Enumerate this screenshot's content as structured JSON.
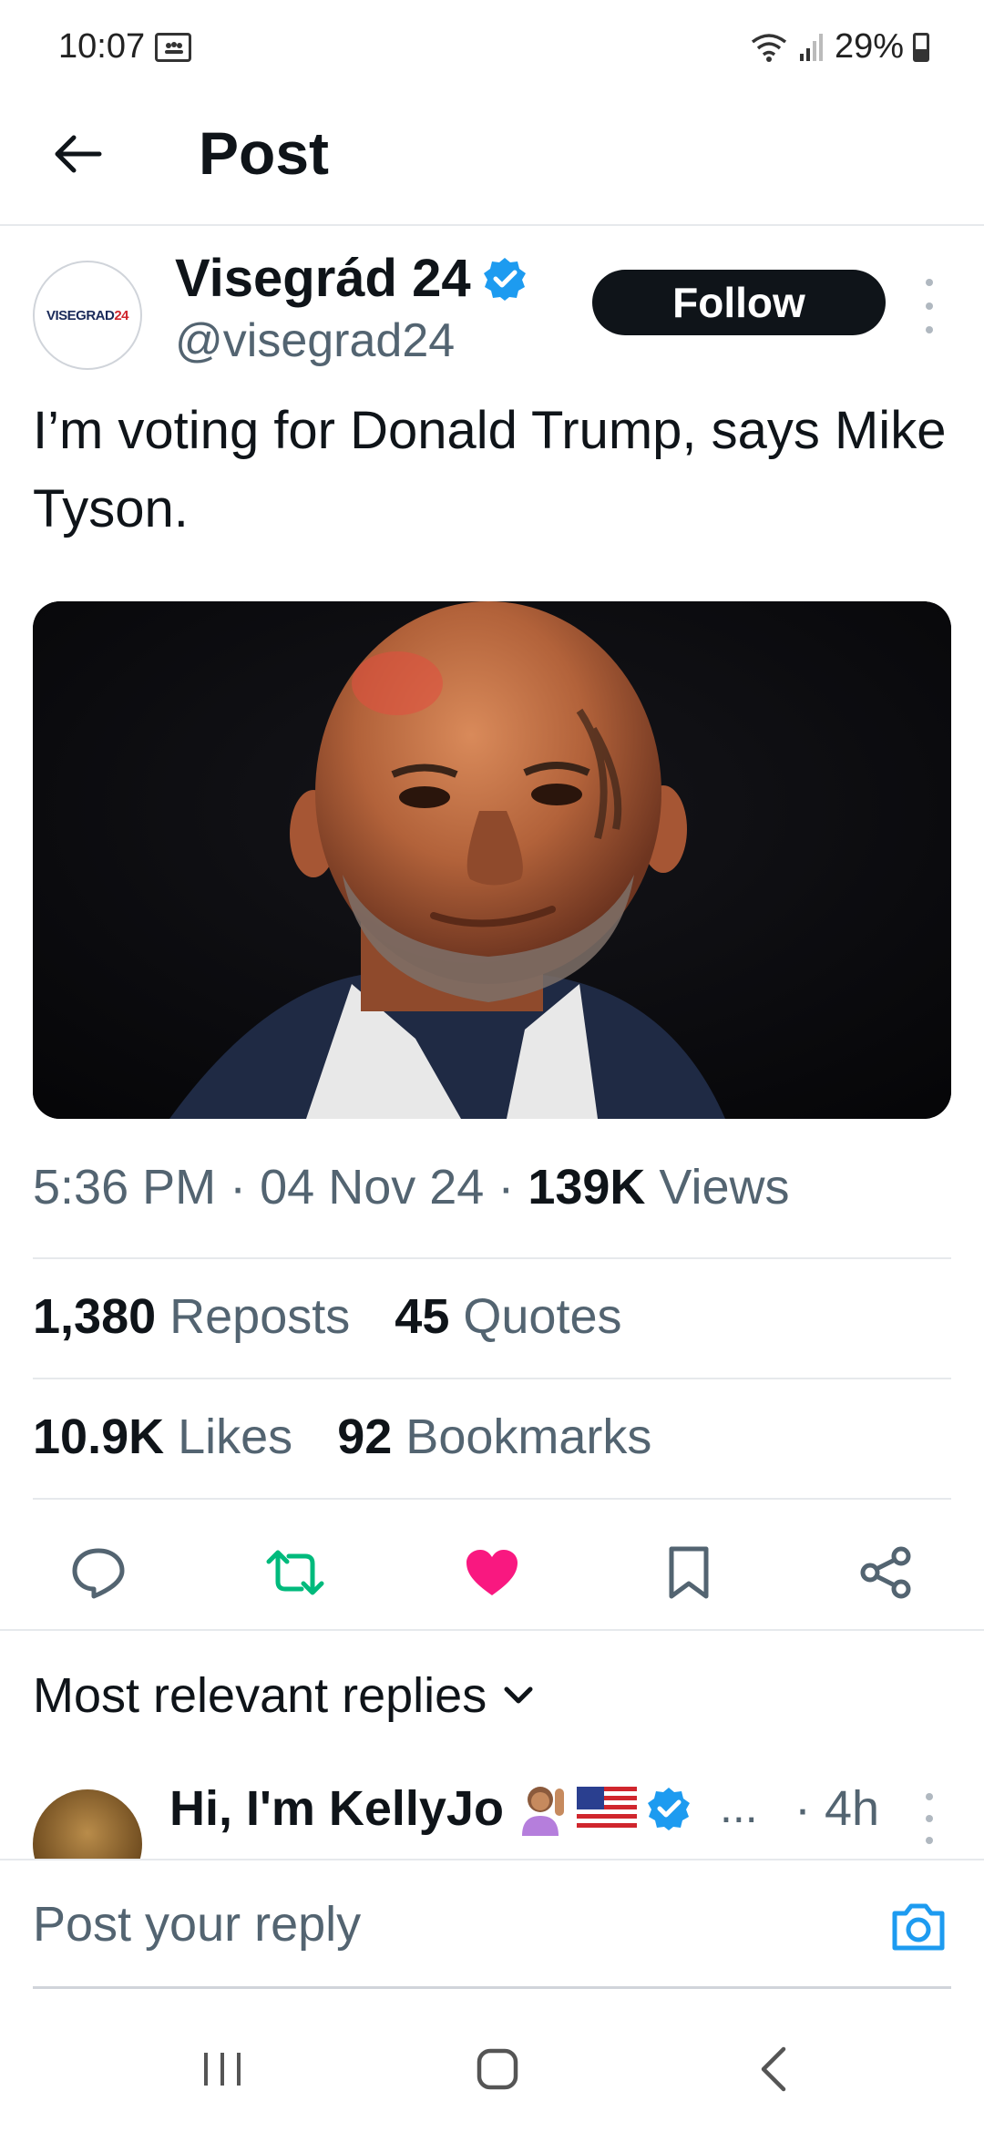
{
  "status_bar": {
    "time": "10:07",
    "battery": "29%"
  },
  "header": {
    "title": "Post"
  },
  "post": {
    "author": {
      "name": "Visegrád 24",
      "handle": "@visegrad24",
      "avatar_text_a": "VISEGRAD",
      "avatar_text_b": "24",
      "verified": true
    },
    "follow_label": "Follow",
    "text": "I’m voting for Donald Trump, says Mike Tyson.",
    "time": "5:36 PM",
    "date": "04 Nov 24",
    "views_count": "139K",
    "views_label": "Views",
    "sep": "·",
    "reposts_count": "1,380",
    "reposts_label": "Reposts",
    "quotes_count": "45",
    "quotes_label": "Quotes",
    "likes_count": "10.9K",
    "likes_label": "Likes",
    "bookmarks_count": "92",
    "bookmarks_label": "Bookmarks"
  },
  "actions": {
    "reply_icon": "reply-icon",
    "repost_icon": "repost-icon",
    "like_icon": "heart-icon",
    "bookmark_icon": "bookmark-icon",
    "share_icon": "share-icon",
    "repost_color": "#00ba7c",
    "like_color": "#f91880"
  },
  "replies": {
    "sort_label": "Most relevant replies",
    "first": {
      "name": "Hi, I'm KellyJo",
      "ellipsis": "...",
      "time": "· 4h"
    }
  },
  "composer": {
    "placeholder": "Post your reply"
  },
  "colors": {
    "accent": "#1d9bf0",
    "text": "#0f1419",
    "muted": "#536471"
  }
}
